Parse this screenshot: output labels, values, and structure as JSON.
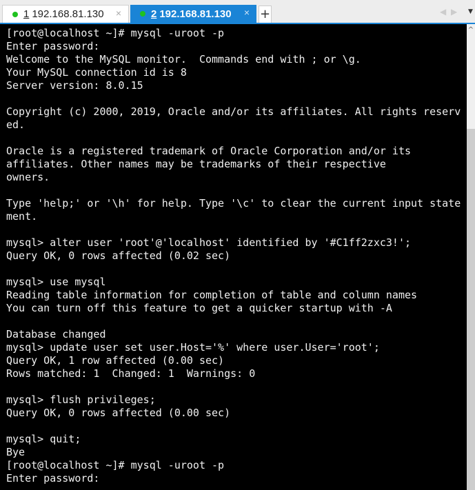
{
  "tabs": [
    {
      "number": "1",
      "label": "192.168.81.130",
      "active": false,
      "status_color": "#1fc21f"
    },
    {
      "number": "2",
      "label": "192.168.81.130",
      "active": true,
      "status_color": "#1fc21f"
    }
  ],
  "icons": {
    "close": "×",
    "new_tab": "+",
    "prev": "◀",
    "next": "▶",
    "menu": "▼",
    "scroll_up": "^"
  },
  "accent": "#1a84d6",
  "terminal": {
    "lines": [
      "[root@localhost ~]# mysql -uroot -p",
      "Enter password:",
      "Welcome to the MySQL monitor.  Commands end with ; or \\g.",
      "Your MySQL connection id is 8",
      "Server version: 8.0.15",
      "",
      "Copyright (c) 2000, 2019, Oracle and/or its affiliates. All rights reserv",
      "ed.",
      "",
      "Oracle is a registered trademark of Oracle Corporation and/or its",
      "affiliates. Other names may be trademarks of their respective",
      "owners.",
      "",
      "Type 'help;' or '\\h' for help. Type '\\c' to clear the current input state",
      "ment.",
      "",
      "mysql> alter user 'root'@'localhost' identified by '#C1ff2zxc3!';",
      "Query OK, 0 rows affected (0.02 sec)",
      "",
      "mysql> use mysql",
      "Reading table information for completion of table and column names",
      "You can turn off this feature to get a quicker startup with -A",
      "",
      "Database changed",
      "mysql> update user set user.Host='%' where user.User='root';",
      "Query OK, 1 row affected (0.00 sec)",
      "Rows matched: 1  Changed: 1  Warnings: 0",
      "",
      "mysql> flush privileges;",
      "Query OK, 0 rows affected (0.00 sec)",
      "",
      "mysql> quit;",
      "Bye",
      "[root@localhost ~]# mysql -uroot -p",
      "Enter password:"
    ]
  }
}
